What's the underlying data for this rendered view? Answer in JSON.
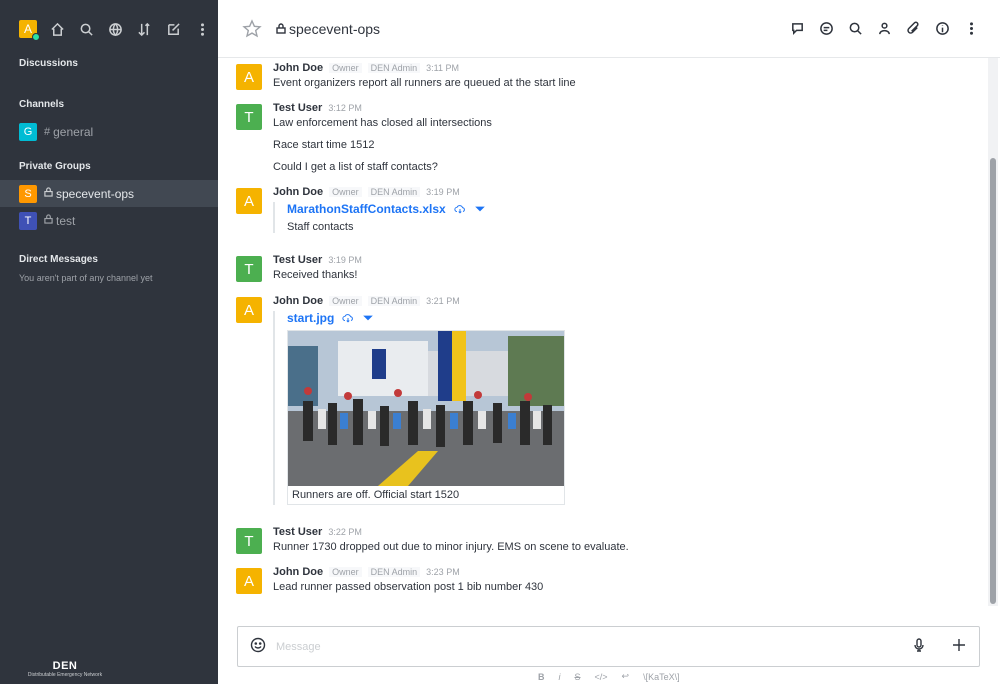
{
  "sidebar": {
    "user_initial": "A",
    "sections": {
      "discussions": "Discussions",
      "channels": "Channels",
      "private_groups": "Private Groups",
      "direct_messages": "Direct Messages"
    },
    "channels": [
      {
        "initial": "G",
        "name": "general",
        "color": "#00bcd4"
      }
    ],
    "private_groups": [
      {
        "initial": "S",
        "name": "specevent-ops",
        "color": "#ff9800"
      },
      {
        "initial": "T",
        "name": "test",
        "color": "#3f51b5"
      }
    ],
    "dm_empty": "You aren't part of any channel yet",
    "brand": {
      "name": "DEN",
      "subtitle": "Distributable Emergency Network"
    }
  },
  "header": {
    "room_name": "specevent-ops"
  },
  "messages": [
    {
      "initial": "A",
      "avatar_color": "#f5b300",
      "user": "John Doe",
      "roles": [
        "Owner",
        "DEN Admin"
      ],
      "time": "3:11 PM",
      "lines": [
        "Event organizers report all runners are queued at the start line"
      ]
    },
    {
      "initial": "T",
      "avatar_color": "#4caf50",
      "user": "Test User",
      "roles": [],
      "time": "3:12 PM",
      "lines": [
        "Law enforcement has closed all intersections",
        "Race start time 1512",
        "Could I get a list of staff contacts?"
      ]
    },
    {
      "initial": "A",
      "avatar_color": "#f5b300",
      "user": "John Doe",
      "roles": [
        "Owner",
        "DEN Admin"
      ],
      "time": "3:19 PM",
      "attachment": {
        "name": "MarathonStaffContacts.xlsx",
        "description": "Staff contacts"
      }
    },
    {
      "initial": "T",
      "avatar_color": "#4caf50",
      "user": "Test User",
      "roles": [],
      "time": "3:19 PM",
      "lines": [
        "Received thanks!"
      ]
    },
    {
      "initial": "A",
      "avatar_color": "#f5b300",
      "user": "John Doe",
      "roles": [
        "Owner",
        "DEN Admin"
      ],
      "time": "3:21 PM",
      "image_attachment": {
        "name": "start.jpg",
        "caption": "Runners are off. Official start 1520"
      }
    },
    {
      "initial": "T",
      "avatar_color": "#4caf50",
      "user": "Test User",
      "roles": [],
      "time": "3:22 PM",
      "lines": [
        "Runner 1730 dropped out due to minor injury. EMS on scene to evaluate."
      ]
    },
    {
      "initial": "A",
      "avatar_color": "#f5b300",
      "user": "John Doe",
      "roles": [
        "Owner",
        "DEN Admin"
      ],
      "time": "3:23 PM",
      "lines": [
        "Lead runner passed observation post 1 bib number 430"
      ]
    }
  ],
  "composer": {
    "placeholder": "Message",
    "format_tools": [
      "B",
      "i",
      "S",
      "</>",
      "↩",
      "\\[KaTeX\\]"
    ]
  },
  "colors": {
    "sidebar_bg": "#2f343d",
    "link": "#1d74f5"
  }
}
